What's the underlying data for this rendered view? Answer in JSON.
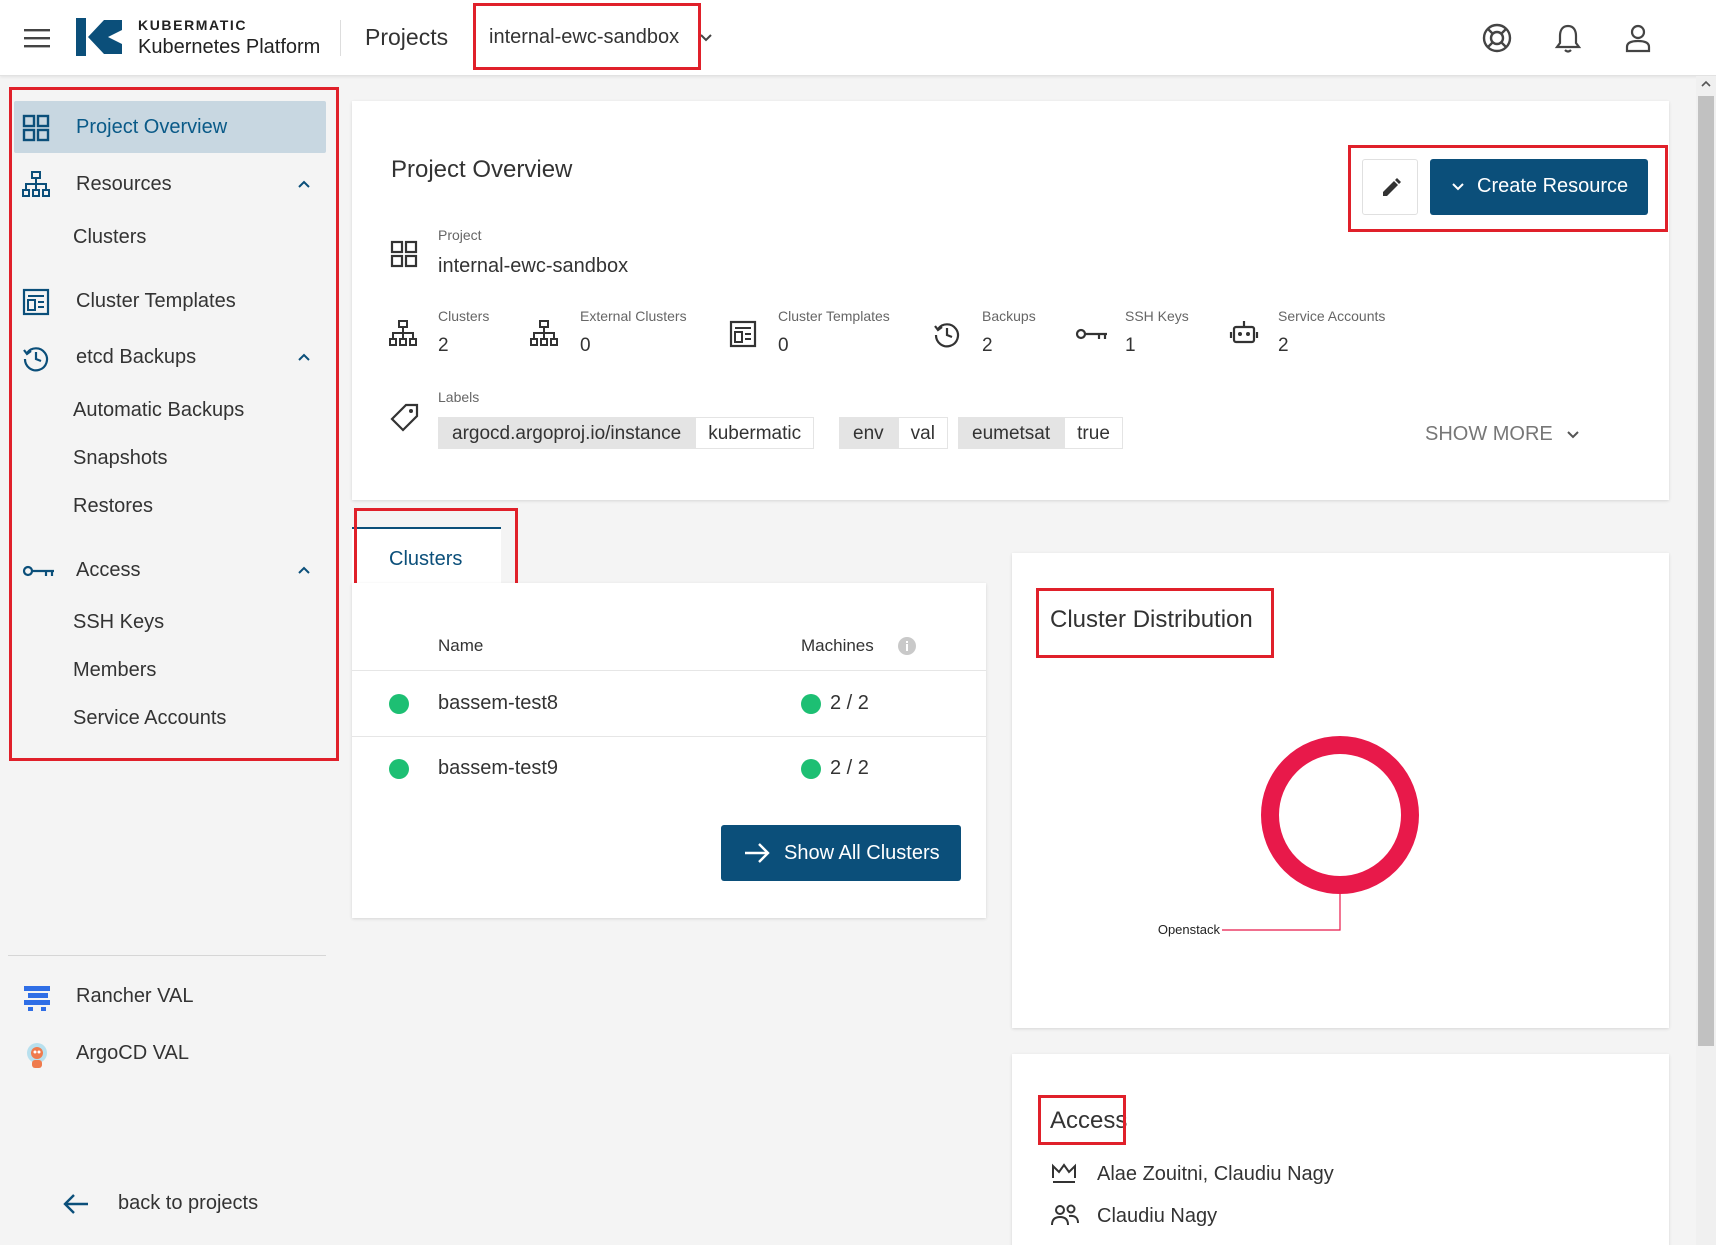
{
  "header": {
    "brand_top": "KUBERMATIC",
    "brand_bottom": "Kubernetes Platform",
    "projects_label": "Projects",
    "project_selected": "internal-ewc-sandbox"
  },
  "sidebar": {
    "items": [
      {
        "label": "Project Overview",
        "icon": "grid-icon",
        "active": true
      },
      {
        "label": "Resources",
        "icon": "sitemap-icon",
        "expanded": true
      },
      {
        "label": "Clusters"
      },
      {
        "label": "Cluster Templates",
        "icon": "template-icon"
      },
      {
        "label": "etcd Backups",
        "icon": "history-icon",
        "expanded": true
      },
      {
        "label": "Automatic Backups"
      },
      {
        "label": "Snapshots"
      },
      {
        "label": "Restores"
      },
      {
        "label": "Access",
        "icon": "key-icon",
        "expanded": true
      },
      {
        "label": "SSH Keys"
      },
      {
        "label": "Members"
      },
      {
        "label": "Service Accounts"
      }
    ],
    "external": [
      {
        "label": "Rancher VAL",
        "icon": "rancher-logo-icon"
      },
      {
        "label": "ArgoCD VAL",
        "icon": "argocd-logo-icon"
      }
    ],
    "back_label": "back to projects"
  },
  "overview": {
    "title": "Project Overview",
    "project_label": "Project",
    "project_name": "internal-ewc-sandbox",
    "create_button": "Create Resource",
    "stats": [
      {
        "label": "Clusters",
        "value": "2",
        "icon": "sitemap-icon"
      },
      {
        "label": "External Clusters",
        "value": "0",
        "icon": "sitemap-icon"
      },
      {
        "label": "Cluster Templates",
        "value": "0",
        "icon": "template-icon"
      },
      {
        "label": "Backups",
        "value": "2",
        "icon": "history-icon"
      },
      {
        "label": "SSH Keys",
        "value": "1",
        "icon": "key-icon"
      },
      {
        "label": "Service Accounts",
        "value": "2",
        "icon": "robot-icon"
      }
    ],
    "labels_title": "Labels",
    "labels": [
      {
        "key": "argocd.argoproj.io/instance",
        "value": "kubermatic"
      },
      {
        "key": "env",
        "value": "val"
      },
      {
        "key": "eumetsat",
        "value": "true"
      }
    ],
    "show_more": "SHOW MORE"
  },
  "clusters_tab": {
    "tab_label": "Clusters",
    "col_name": "Name",
    "col_machines": "Machines",
    "rows": [
      {
        "name": "bassem-test8",
        "machines": "2 / 2"
      },
      {
        "name": "bassem-test9",
        "machines": "2 / 2"
      }
    ],
    "show_all": "Show All Clusters"
  },
  "distribution": {
    "title": "Cluster Distribution",
    "chart_data": {
      "type": "pie",
      "categories": [
        "Openstack"
      ],
      "values": [
        2
      ],
      "colors": [
        "#e8194a"
      ]
    }
  },
  "access": {
    "title": "Access",
    "owners": "Alae Zouitni, Claudiu Nagy",
    "members": "Claudiu Nagy"
  },
  "colors": {
    "primary": "#0b4f7a",
    "accent_red": "#e8194a",
    "status_green": "#1dbf73",
    "annotation_red": "#e0202a"
  }
}
